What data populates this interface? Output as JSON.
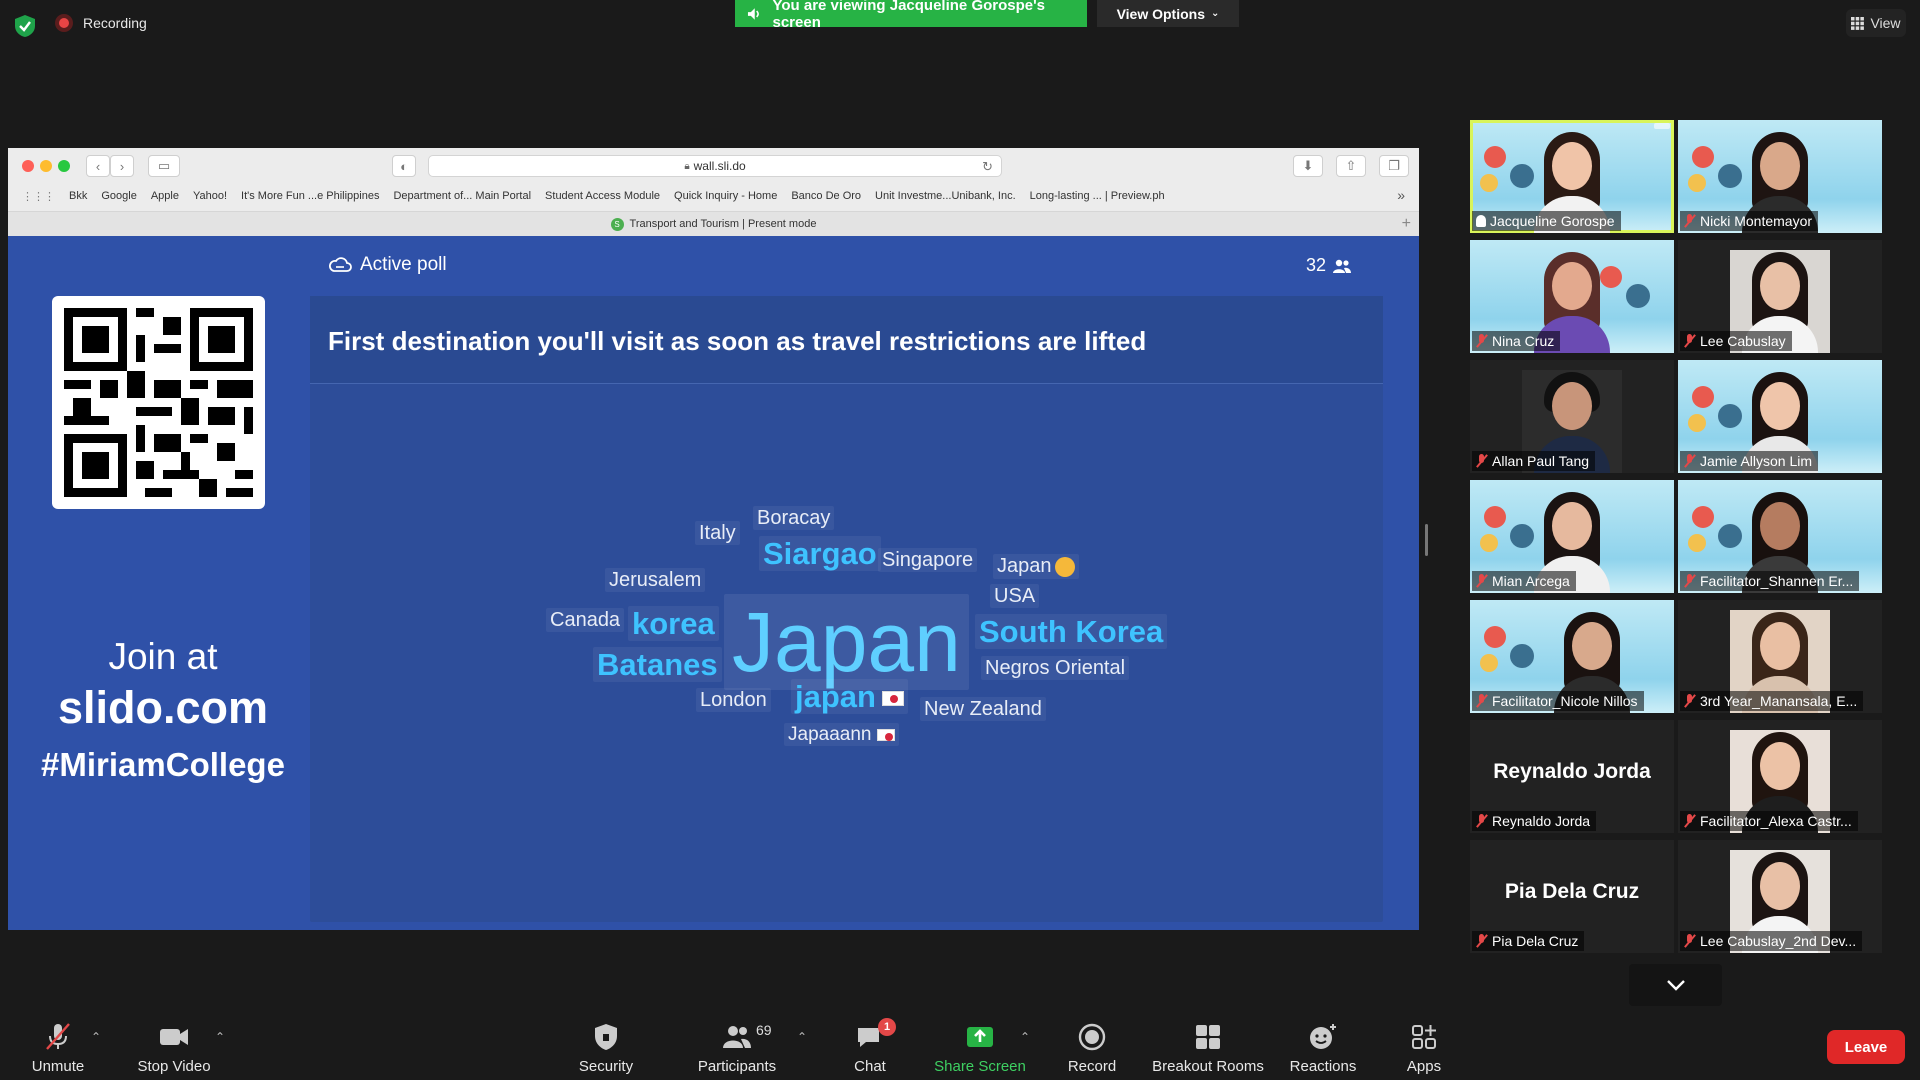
{
  "top": {
    "recording_label": "Recording",
    "viewing_banner": "You are viewing Jacqueline Gorospe's screen",
    "view_options": "View Options",
    "view_button": "View"
  },
  "browser": {
    "url": "wall.sli.do",
    "bookmarks": [
      "Bkk",
      "Google",
      "Apple",
      "Yahoo!",
      "It's More Fun ...e Philippines",
      "Department of... Main Portal",
      "Student Access Module",
      "Quick Inquiry - Home",
      "Banco De Oro",
      "Unit Investme...Unibank, Inc.",
      "Long-lasting ... | Preview.ph"
    ],
    "tab_title": "Transport and Tourism | Present mode"
  },
  "slide": {
    "join_at": "Join at",
    "site": "slido.com",
    "hashtag": "#MiriamCollege",
    "poll_label": "Active poll",
    "participant_count": "32",
    "question": "First destination you'll visit as soon as travel restrictions are lifted",
    "words": [
      "Boracay",
      "Italy",
      "Siargao",
      "Singapore",
      "Japan",
      "Jerusalem",
      "USA",
      "Canada",
      "korea",
      "Japan",
      "South Korea",
      "Batanes",
      "Negros Oriental",
      "London",
      "japan",
      "New Zealand",
      "Japaaann"
    ]
  },
  "gallery": [
    {
      "name": "Jacqueline Gorospe"
    },
    {
      "name": "Nicki Montemayor"
    },
    {
      "name": "Nina Cruz"
    },
    {
      "name": "Lee Cabuslay"
    },
    {
      "name": "Allan Paul Tang"
    },
    {
      "name": "Jamie Allyson Lim"
    },
    {
      "name": "Mian Arcega"
    },
    {
      "name": "Facilitator_Shannen Er..."
    },
    {
      "name": "Facilitator_Nicole Nillos"
    },
    {
      "name": "3rd Year_Manansala, E..."
    },
    {
      "name": "Reynaldo Jorda",
      "display": "Reynaldo Jorda"
    },
    {
      "name": "Facilitator_Alexa Castr..."
    },
    {
      "name": "Pia Dela Cruz",
      "display": "Pia Dela Cruz"
    },
    {
      "name": "Lee Cabuslay_2nd Dev..."
    }
  ],
  "toolbar": {
    "unmute": "Unmute",
    "stop_video": "Stop Video",
    "security": "Security",
    "participants": "Participants",
    "participants_count": "69",
    "chat": "Chat",
    "chat_badge": "1",
    "share_screen": "Share Screen",
    "record": "Record",
    "breakout": "Breakout Rooms",
    "reactions": "Reactions",
    "apps": "Apps",
    "leave": "Leave"
  },
  "colors": {
    "accent_green": "#27b345",
    "slide_blue": "#2f51a8",
    "leave_red": "#e02828",
    "word_blue": "#3ec3ff"
  }
}
